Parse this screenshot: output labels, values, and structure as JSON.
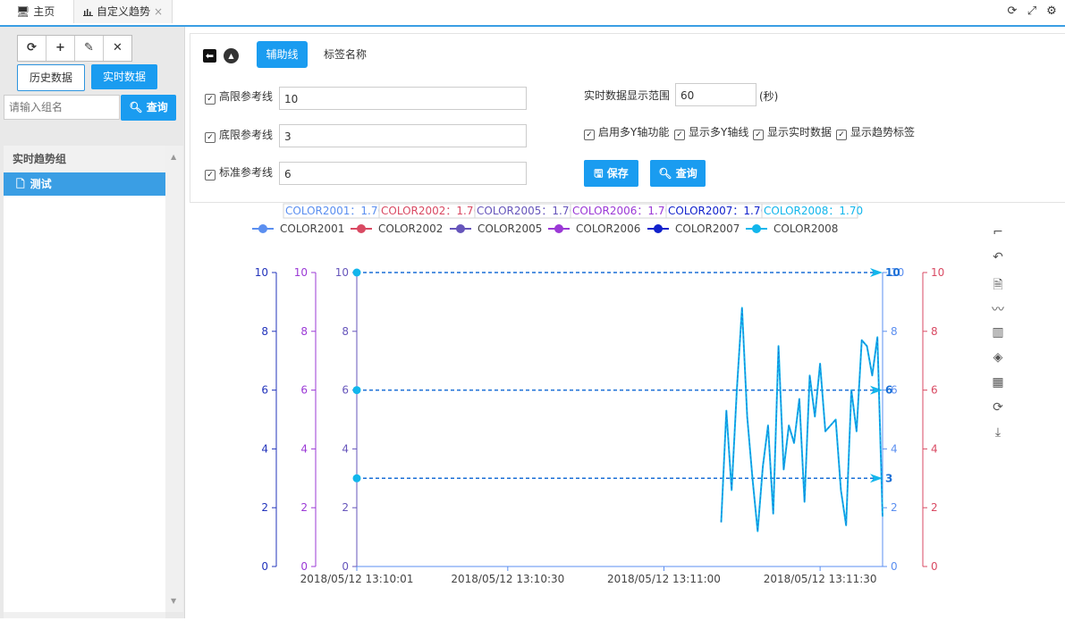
{
  "tabs": {
    "home": {
      "label": "主页"
    },
    "trend": {
      "label": "自定义趋势",
      "close": "×"
    }
  },
  "window_tools": [
    "refresh-icon",
    "fullscreen-icon",
    "settings-icon"
  ],
  "left": {
    "toolbar": [
      {
        "name": "refresh-icon",
        "glyph": "⟳"
      },
      {
        "name": "plus-icon",
        "glyph": "+"
      },
      {
        "name": "edit-icon",
        "glyph": "✎"
      },
      {
        "name": "delete-icon",
        "glyph": "✕"
      }
    ],
    "history_btn": "历史数据",
    "realtime_btn": "实时数据",
    "group_input_placeholder": "请输入组名",
    "query_btn": "查询",
    "tree_header": "实时趋势组",
    "tree_items": [
      "测试"
    ]
  },
  "settings": {
    "tab_active": "辅助线",
    "tab_other": "标签名称",
    "high_label": "高限参考线",
    "high_value": "10",
    "low_label": "底限参考线",
    "low_value": "3",
    "std_label": "标准参考线",
    "std_value": "6",
    "range_label": "实时数据显示范围",
    "range_value": "60",
    "range_unit": "(秒)",
    "opt_multi_y": "启用多Y轴功能",
    "opt_show_y": "显示多Y轴线",
    "opt_show_real": "显示实时数据",
    "opt_show_label": "显示趋势标签",
    "save_btn": "保存",
    "query_btn": "查询"
  },
  "colors": {
    "accent": "#1a9cf0",
    "COLOR2001": "#5b8ff0",
    "COLOR2002": "#d94a63",
    "COLOR2005": "#6655bb",
    "COLOR2006": "#9b39d6",
    "COLOR2007": "#1122cc",
    "COLOR2008": "#12b6ec"
  },
  "chart_data": {
    "type": "line",
    "data_labels": [
      {
        "name": "COLOR2001",
        "value": "1.70",
        "color": "#5b8ff0"
      },
      {
        "name": "COLOR2002",
        "value": "1.70",
        "color": "#d94a63"
      },
      {
        "name": "COLOR2005",
        "value": "1.70",
        "color": "#6655bb"
      },
      {
        "name": "COLOR2006",
        "value": "1.70",
        "color": "#9b39d6"
      },
      {
        "name": "COLOR2007",
        "value": "1.70",
        "color": "#1122cc"
      },
      {
        "name": "COLOR2008",
        "value": "1.70",
        "color": "#12b6ec"
      }
    ],
    "legend": [
      {
        "name": "COLOR2001",
        "color": "#5b8ff0"
      },
      {
        "name": "COLOR2002",
        "color": "#d94a63"
      },
      {
        "name": "COLOR2005",
        "color": "#6655bb"
      },
      {
        "name": "COLOR2006",
        "color": "#9b39d6"
      },
      {
        "name": "COLOR2007",
        "color": "#1122cc"
      },
      {
        "name": "COLOR2008",
        "color": "#12b6ec"
      }
    ],
    "ylim": [
      0,
      10
    ],
    "yticks": [
      0,
      2,
      4,
      6,
      8,
      10
    ],
    "y_axes": [
      {
        "position": "left-outer",
        "color": "#2233bb"
      },
      {
        "position": "left-middle",
        "color": "#9b39d6"
      },
      {
        "position": "left-inner",
        "color": "#6655bb"
      },
      {
        "position": "right-inner",
        "color": "#5b8ff0"
      },
      {
        "position": "right-outer",
        "color": "#d94a63"
      }
    ],
    "xlim": [
      "2018/05/12 13:10:01",
      "2018/05/12 13:11:42"
    ],
    "x_tick_labels": [
      "2018/05/12 13:10:01",
      "2018/05/12 13:10:30",
      "2018/05/12 13:11:00",
      "2018/05/12 13:11:30"
    ],
    "x_tick_values": [
      "2018/05/12 13:10:01",
      "2018/05/12 13:10:30",
      "2018/05/12 13:11:00",
      "2018/05/12 13:11:30"
    ],
    "reference_lines": [
      {
        "value": 10,
        "label": "10"
      },
      {
        "value": 6,
        "label": "6"
      },
      {
        "value": 3,
        "label": "3"
      }
    ],
    "series": [
      {
        "name": "COLOR2001",
        "color": "#12b6ec",
        "x": [
          "2018/05/12 13:11:11",
          "2018/05/12 13:11:12",
          "2018/05/12 13:11:13",
          "2018/05/12 13:11:14",
          "2018/05/12 13:11:15",
          "2018/05/12 13:11:16",
          "2018/05/12 13:11:17",
          "2018/05/12 13:11:18",
          "2018/05/12 13:11:19",
          "2018/05/12 13:11:20",
          "2018/05/12 13:11:21",
          "2018/05/12 13:11:22",
          "2018/05/12 13:11:23",
          "2018/05/12 13:11:24",
          "2018/05/12 13:11:25",
          "2018/05/12 13:11:26",
          "2018/05/12 13:11:27",
          "2018/05/12 13:11:28",
          "2018/05/12 13:11:29",
          "2018/05/12 13:11:30",
          "2018/05/12 13:11:31",
          "2018/05/12 13:11:32",
          "2018/05/12 13:11:33",
          "2018/05/12 13:11:34",
          "2018/05/12 13:11:35",
          "2018/05/12 13:11:36",
          "2018/05/12 13:11:37",
          "2018/05/12 13:11:38",
          "2018/05/12 13:11:39",
          "2018/05/12 13:11:40",
          "2018/05/12 13:11:41",
          "2018/05/12 13:11:42"
        ],
        "values": [
          1.5,
          5.3,
          2.6,
          6.0,
          8.8,
          5.1,
          3.0,
          1.2,
          3.4,
          4.8,
          1.8,
          7.5,
          3.3,
          4.8,
          4.2,
          5.7,
          2.2,
          6.5,
          5.1,
          6.9,
          4.6,
          4.8,
          5.0,
          2.6,
          1.4,
          6.0,
          4.6,
          7.7,
          7.5,
          6.5,
          7.8,
          1.7
        ]
      }
    ]
  }
}
